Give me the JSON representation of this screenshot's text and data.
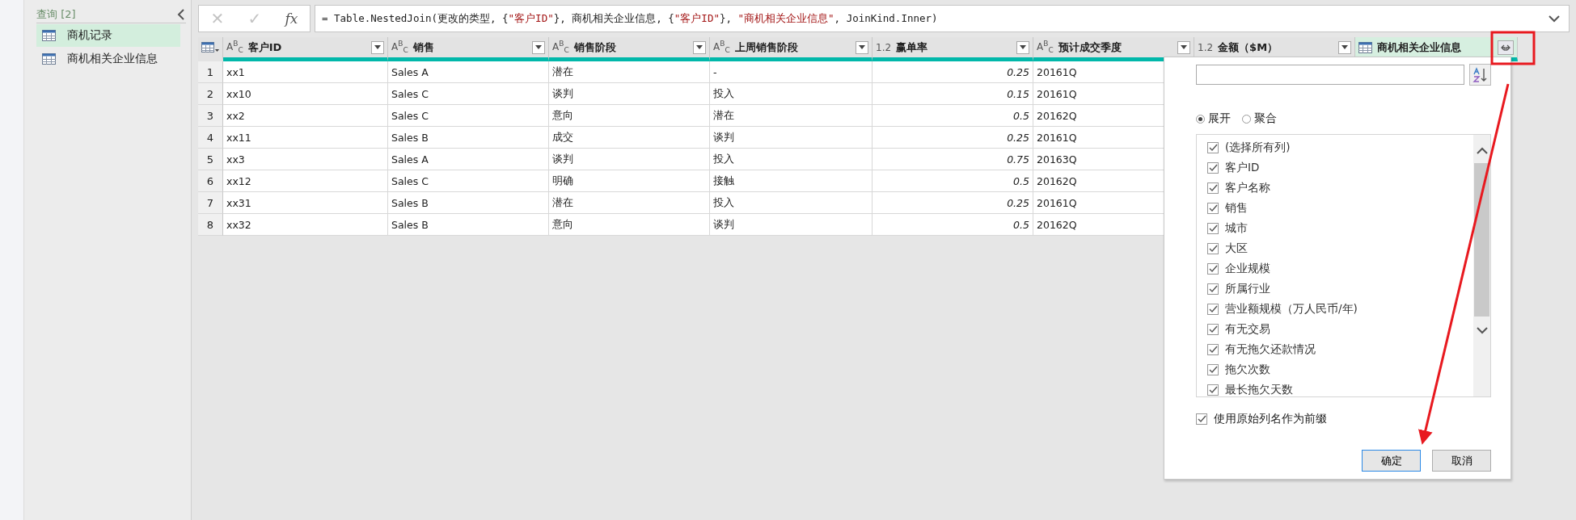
{
  "queries_pane": {
    "title": "查询 [2]",
    "items": [
      {
        "label": "商机记录",
        "selected": true
      },
      {
        "label": "商机相关企业信息",
        "selected": false
      }
    ]
  },
  "formula_bar": {
    "buttons": [
      {
        "label": "✕",
        "kind": "cancel",
        "disabled": true
      },
      {
        "label": "✓",
        "kind": "commit",
        "disabled": true
      },
      {
        "label": "fx",
        "kind": "function",
        "disabled": false
      }
    ],
    "tokens": [
      {
        "text": "= Table.NestedJoin(更改的类型, {",
        "kind": "plain"
      },
      {
        "text": "\"客户ID\"",
        "kind": "string"
      },
      {
        "text": "}, 商机相关企业信息, {",
        "kind": "plain"
      },
      {
        "text": "\"客户ID\"",
        "kind": "string"
      },
      {
        "text": "}, ",
        "kind": "plain"
      },
      {
        "text": "\"商机相关企业信息\"",
        "kind": "string"
      },
      {
        "text": ", JoinKind.Inner)",
        "kind": "plain"
      }
    ]
  },
  "table": {
    "columns": [
      {
        "type_label": "A$^{B}$$_{C}$",
        "name": "客户ID",
        "kind": "text"
      },
      {
        "type_label": "A$^{B}$$_{C}$",
        "name": "销售",
        "kind": "text"
      },
      {
        "type_label": "A$^{B}$$_{C}$",
        "name": "销售阶段",
        "kind": "text"
      },
      {
        "type_label": "A$^{B}$$_{C}$",
        "name": "上周销售阶段",
        "kind": "text"
      },
      {
        "type_label": "1.2",
        "name": "赢单率",
        "kind": "number"
      },
      {
        "type_label": "A$^{B}$$_{C}$",
        "name": "预计成交季度",
        "kind": "text"
      },
      {
        "type_label": "1.2",
        "name": "金额（$M）",
        "kind": "number"
      },
      {
        "name": "商机相关企业信息",
        "kind": "table"
      }
    ],
    "rows": [
      {
        "number": "1",
        "cells": [
          "xx1",
          "Sales A",
          "潜在",
          "-",
          "0.25",
          "20161Q"
        ]
      },
      {
        "number": "2",
        "cells": [
          "xx10",
          "Sales C",
          "谈判",
          "投入",
          "0.15",
          "20161Q"
        ]
      },
      {
        "number": "3",
        "cells": [
          "xx2",
          "Sales C",
          "意向",
          "潜在",
          "0.5",
          "20162Q"
        ]
      },
      {
        "number": "4",
        "cells": [
          "xx11",
          "Sales B",
          "成交",
          "谈判",
          "0.25",
          "20161Q"
        ]
      },
      {
        "number": "5",
        "cells": [
          "xx3",
          "Sales A",
          "谈判",
          "投入",
          "0.75",
          "20163Q"
        ]
      },
      {
        "number": "6",
        "cells": [
          "xx12",
          "Sales C",
          "明确",
          "接触",
          "0.5",
          "20162Q"
        ]
      },
      {
        "number": "7",
        "cells": [
          "xx31",
          "Sales B",
          "潜在",
          "投入",
          "0.25",
          "20161Q"
        ]
      },
      {
        "number": "8",
        "cells": [
          "xx32",
          "Sales B",
          "意向",
          "谈判",
          "0.5",
          "20162Q"
        ]
      }
    ]
  },
  "expand_popup": {
    "modes": [
      {
        "label": "展开",
        "selected": true
      },
      {
        "label": "聚合",
        "selected": false
      }
    ],
    "columns": [
      {
        "label": "(选择所有列)",
        "checked": true
      },
      {
        "label": "客户ID",
        "checked": true
      },
      {
        "label": "客户名称",
        "checked": true
      },
      {
        "label": "销售",
        "checked": true
      },
      {
        "label": "城市",
        "checked": true
      },
      {
        "label": "大区",
        "checked": true
      },
      {
        "label": "企业规模",
        "checked": true
      },
      {
        "label": "所属行业",
        "checked": true
      },
      {
        "label": "营业额规模（万人民币/年)",
        "checked": true
      },
      {
        "label": "有无交易",
        "checked": true
      },
      {
        "label": "有无拖欠还款情况",
        "checked": true
      },
      {
        "label": "拖欠次数",
        "checked": true
      },
      {
        "label": "最长拖欠天数",
        "checked": true
      }
    ],
    "prefix_option": {
      "label": "使用原始列名作为前缀",
      "checked": true
    },
    "buttons": [
      {
        "label": "确定",
        "kind": "primary"
      },
      {
        "label": "取消",
        "kind": "secondary"
      }
    ]
  }
}
